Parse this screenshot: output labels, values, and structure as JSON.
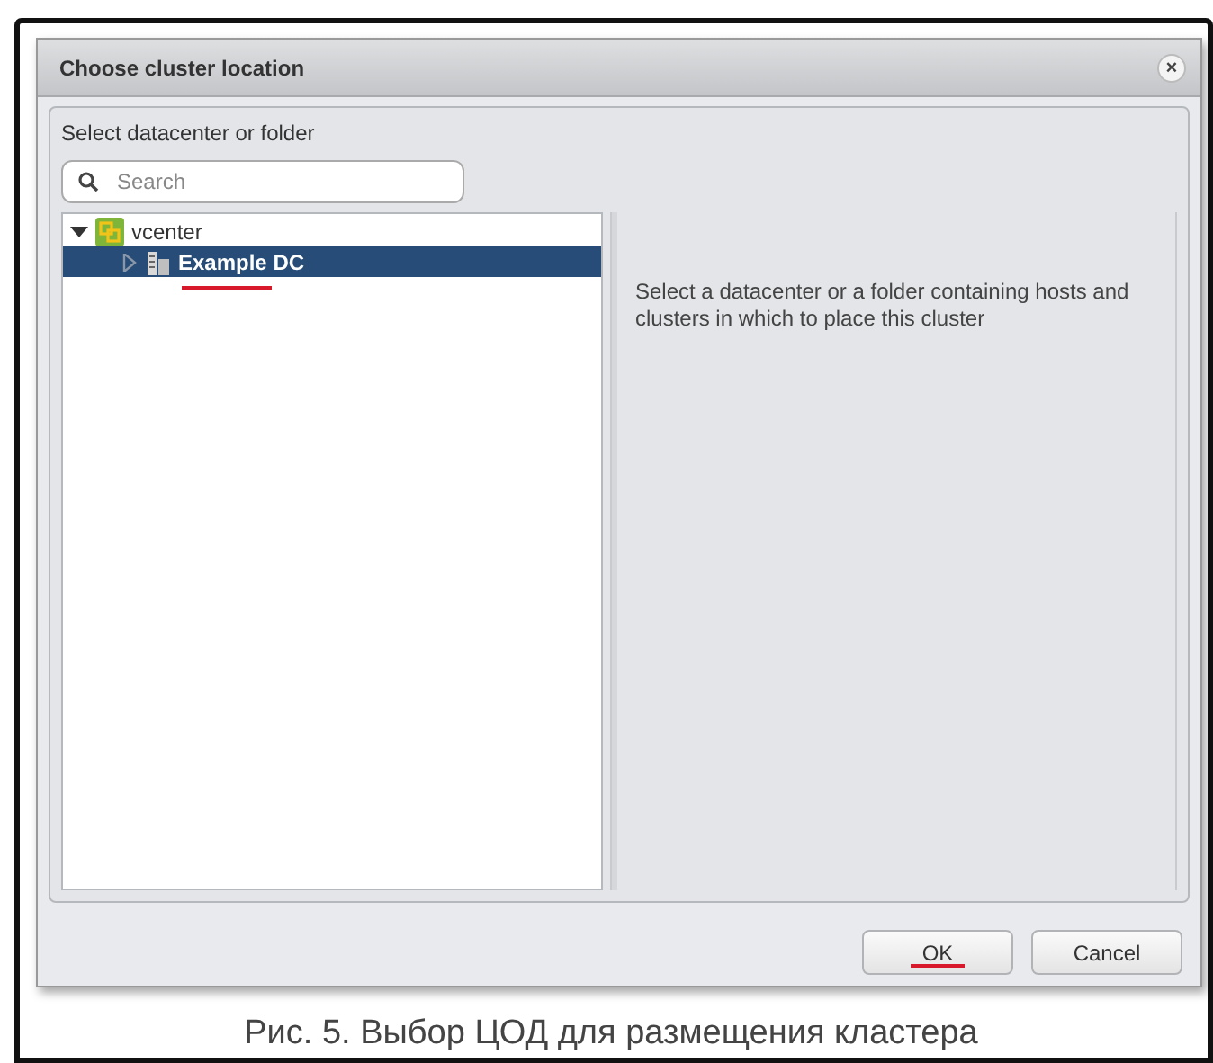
{
  "dialog": {
    "title": "Choose cluster location",
    "close": "×"
  },
  "panel": {
    "heading": "Select datacenter or folder",
    "search": {
      "placeholder": "Search"
    },
    "tree": [
      {
        "label": "vcenter",
        "kind": "vcenter",
        "expanded": true,
        "selected": false,
        "children": [
          {
            "label": "Example DC",
            "kind": "datacenter",
            "expanded": false,
            "selected": true,
            "underlined": true
          }
        ]
      }
    ],
    "info": "Select a datacenter or a folder containing hosts and clusters in which to place this cluster"
  },
  "buttons": [
    {
      "label": "OK",
      "underlined": true
    },
    {
      "label": "Cancel",
      "underlined": false
    }
  ],
  "caption": "Рис. 5. Выбор ЦОД для размещения кластера"
}
